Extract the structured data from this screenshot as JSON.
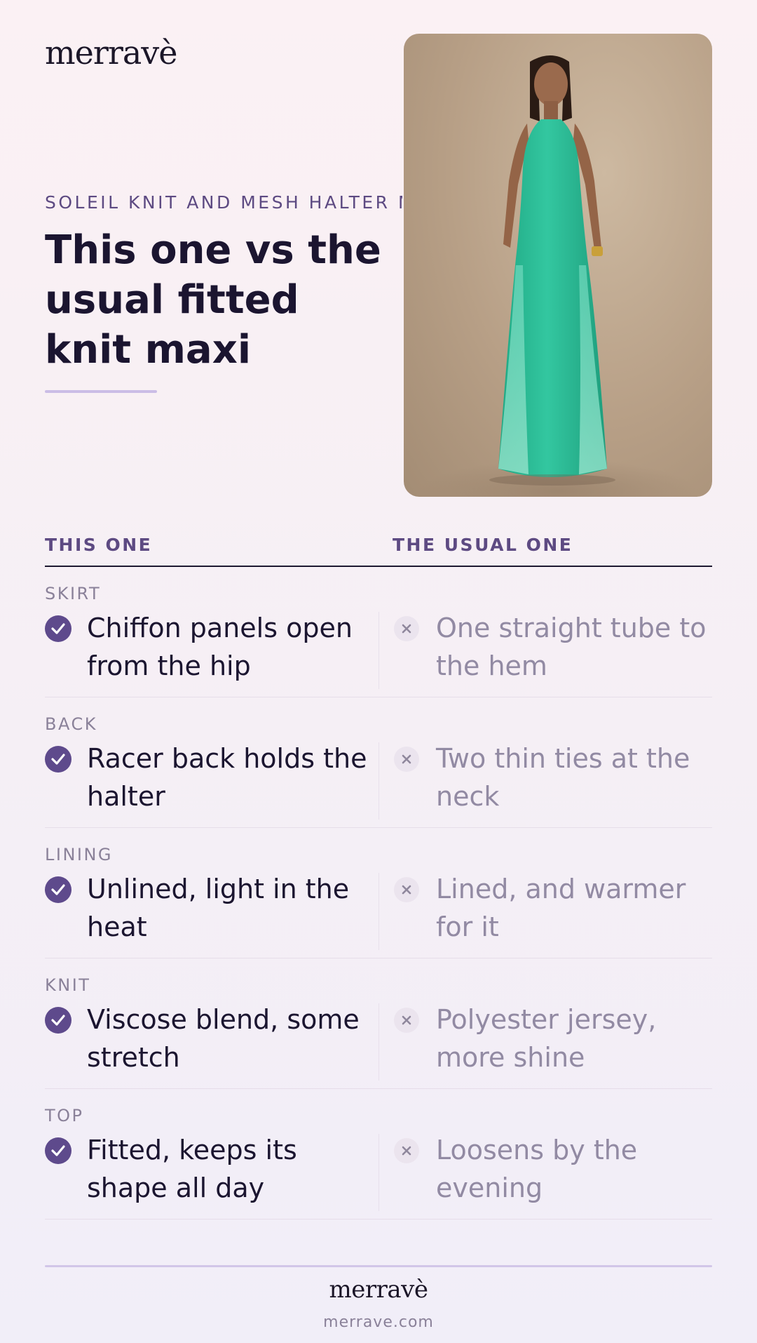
{
  "brand": {
    "logo": "merravè",
    "url": "merrave.com"
  },
  "hero": {
    "eyebrow": "SOLEIL KNIT AND MESH HALTER MAXI",
    "headline": "This one vs the usual fitted knit maxi"
  },
  "colors": {
    "accent": "#5e4a8c",
    "dress": "#2fbf9b",
    "background": "#fbf1f4"
  },
  "icons": {
    "check": "check-circle-icon",
    "cross": "x-circle-icon"
  },
  "table": {
    "headers": {
      "this_one": "THIS ONE",
      "usual_one": "THE USUAL ONE"
    },
    "rows": [
      {
        "label": "SKIRT",
        "this_one": "Chiffon panels open from the hip",
        "usual_one": "One straight tube to the hem"
      },
      {
        "label": "BACK",
        "this_one": "Racer back holds the halter",
        "usual_one": "Two thin ties at the neck"
      },
      {
        "label": "LINING",
        "this_one": "Unlined, light in the heat",
        "usual_one": "Lined, and warmer for it"
      },
      {
        "label": "KNIT",
        "this_one": "Viscose blend, some stretch",
        "usual_one": "Polyester jersey, more shine"
      },
      {
        "label": "TOP",
        "this_one": "Fitted, keeps its shape all day",
        "usual_one": "Loosens by the evening"
      }
    ]
  }
}
